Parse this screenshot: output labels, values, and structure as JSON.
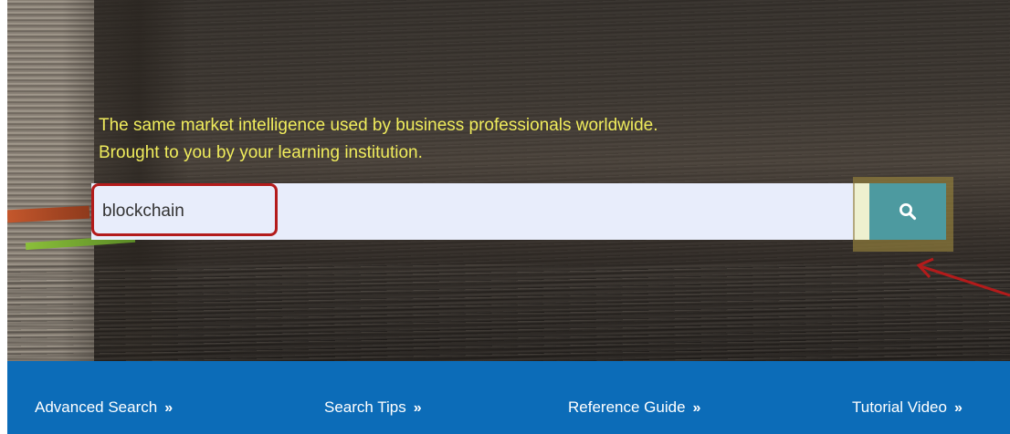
{
  "hero": {
    "tagline_line1": "The same market intelligence used by business professionals worldwide.",
    "tagline_line2": "Brought to you by your learning institution."
  },
  "search": {
    "value": "blockchain",
    "button_icon": "search-icon"
  },
  "nav": {
    "links": [
      {
        "label": "Advanced Search",
        "chevron": "»"
      },
      {
        "label": "Search Tips",
        "chevron": "»"
      },
      {
        "label": "Reference Guide",
        "chevron": "»"
      },
      {
        "label": "Tutorial Video",
        "chevron": "»"
      }
    ]
  },
  "colors": {
    "tagline": "#f0ec5c",
    "search_button": "#4d9aa0",
    "navbar": "#0c6cb8",
    "annotation": "#b31b1b"
  }
}
